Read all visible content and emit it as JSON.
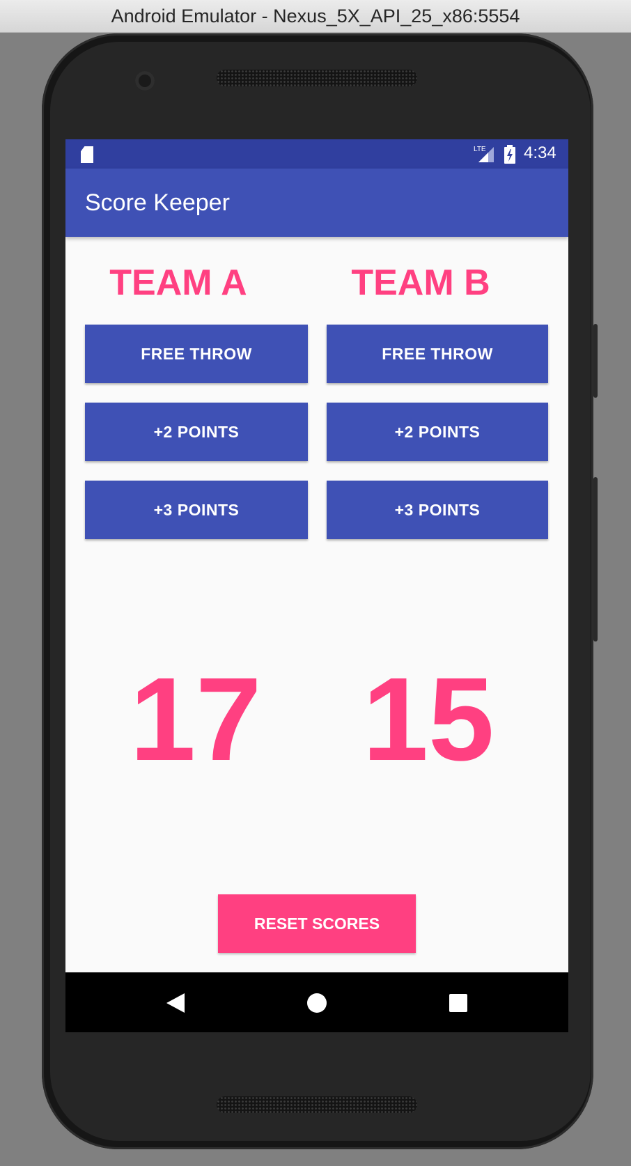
{
  "window": {
    "title": "Android Emulator - Nexus_5X_API_25_x86:5554"
  },
  "status_bar": {
    "time": "4:34",
    "icons": [
      "sd-card-icon",
      "lte-signal-icon",
      "battery-charging-icon"
    ]
  },
  "app_bar": {
    "title": "Score Keeper"
  },
  "team_a": {
    "name": "TEAM A",
    "buttons": [
      "FREE THROW",
      "+2 POINTS",
      "+3 POINTS"
    ],
    "score": "17"
  },
  "team_b": {
    "name": "TEAM B",
    "buttons": [
      "FREE THROW",
      "+2 POINTS",
      "+3 POINTS"
    ],
    "score": "15"
  },
  "reset_label": "RESET SCORES",
  "nav_bar": {
    "icons": [
      "back-icon",
      "home-icon",
      "recents-icon"
    ]
  },
  "colors": {
    "primary": "#3f51b5",
    "primary_dark": "#303f9f",
    "accent": "#ff4081",
    "background": "#fafafa"
  }
}
